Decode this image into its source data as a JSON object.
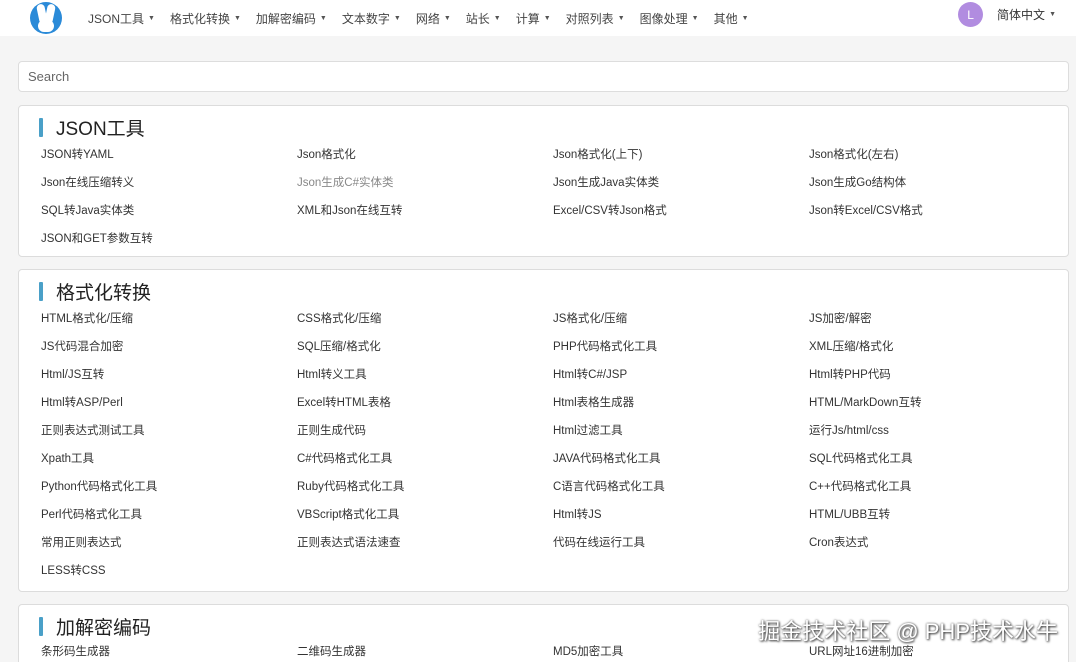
{
  "nav": {
    "menu": [
      {
        "label": "JSON工具"
      },
      {
        "label": "格式化转换"
      },
      {
        "label": "加解密编码"
      },
      {
        "label": "文本数字"
      },
      {
        "label": "网络"
      },
      {
        "label": "站长"
      },
      {
        "label": "计算"
      },
      {
        "label": "对照列表"
      },
      {
        "label": "图像处理"
      },
      {
        "label": "其他"
      }
    ],
    "avatar_initial": "L",
    "language": "简体中文"
  },
  "search": {
    "placeholder": "Search"
  },
  "sections": [
    {
      "title": "JSON工具",
      "items": [
        {
          "label": "JSON转YAML"
        },
        {
          "label": "Json格式化"
        },
        {
          "label": "Json格式化(上下)"
        },
        {
          "label": "Json格式化(左右)"
        },
        {
          "label": "Json在线压缩转义"
        },
        {
          "label": "Json生成C#实体类"
        },
        {
          "label": "Json生成Java实体类"
        },
        {
          "label": "Json生成Go结构体"
        },
        {
          "label": "SQL转Java实体类"
        },
        {
          "label": "XML和Json在线互转"
        },
        {
          "label": "Excel/CSV转Json格式"
        },
        {
          "label": "Json转Excel/CSV格式"
        },
        {
          "label": "JSON和GET参数互转"
        }
      ]
    },
    {
      "title": "格式化转换",
      "items": [
        {
          "label": "HTML格式化/压缩"
        },
        {
          "label": "CSS格式化/压缩"
        },
        {
          "label": "JS格式化/压缩"
        },
        {
          "label": "JS加密/解密"
        },
        {
          "label": "JS代码混合加密"
        },
        {
          "label": "SQL压缩/格式化"
        },
        {
          "label": "PHP代码格式化工具"
        },
        {
          "label": "XML压缩/格式化"
        },
        {
          "label": "Html/JS互转"
        },
        {
          "label": "Html转义工具"
        },
        {
          "label": "Html转C#/JSP"
        },
        {
          "label": "Html转PHP代码"
        },
        {
          "label": "Html转ASP/Perl"
        },
        {
          "label": "Excel转HTML表格"
        },
        {
          "label": "Html表格生成器"
        },
        {
          "label": "HTML/MarkDown互转"
        },
        {
          "label": "正则表达式测试工具"
        },
        {
          "label": "正则生成代码"
        },
        {
          "label": "Html过滤工具"
        },
        {
          "label": "运行Js/html/css"
        },
        {
          "label": "Xpath工具"
        },
        {
          "label": "C#代码格式化工具"
        },
        {
          "label": "JAVA代码格式化工具"
        },
        {
          "label": "SQL代码格式化工具"
        },
        {
          "label": "Python代码格式化工具"
        },
        {
          "label": "Ruby代码格式化工具"
        },
        {
          "label": "C语言代码格式化工具"
        },
        {
          "label": "C++代码格式化工具"
        },
        {
          "label": "Perl代码格式化工具"
        },
        {
          "label": "VBScript格式化工具"
        },
        {
          "label": "Html转JS"
        },
        {
          "label": "HTML/UBB互转"
        },
        {
          "label": "常用正则表达式"
        },
        {
          "label": "正则表达式语法速查"
        },
        {
          "label": "代码在线运行工具"
        },
        {
          "label": "Cron表达式"
        },
        {
          "label": "LESS转CSS"
        }
      ]
    },
    {
      "title": "加解密编码",
      "items": [
        {
          "label": "条形码生成器"
        },
        {
          "label": "二维码生成器"
        },
        {
          "label": "MD5加密工具"
        },
        {
          "label": "URL网址16进制加密"
        }
      ]
    }
  ],
  "watermark": "掘金技术社区 @ PHP技术水牛"
}
